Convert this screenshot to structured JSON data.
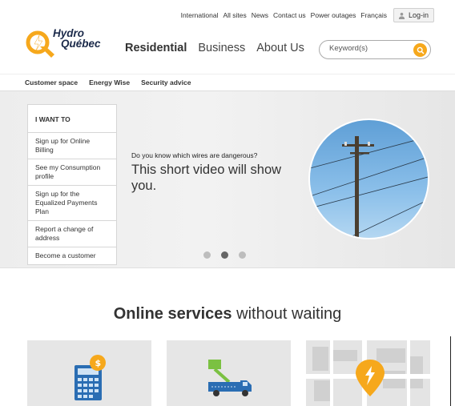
{
  "topbar": {
    "links": [
      "International",
      "All sites",
      "News",
      "Contact us",
      "Power outages",
      "Français"
    ],
    "login_label": "Log-in"
  },
  "logo": {
    "line1": "Hydro",
    "line2": "Québec"
  },
  "mainnav": {
    "items": [
      "Residential",
      "Business",
      "About Us"
    ]
  },
  "search": {
    "placeholder": "Keyword(s)"
  },
  "subnav": {
    "items": [
      "Customer space",
      "Energy Wise",
      "Security advice"
    ]
  },
  "iwant": {
    "title": "I WANT TO",
    "items": [
      "Sign up for Online Billing",
      "See my Consumption profile",
      "Sign up for the Equalized Payments Plan",
      "Report a change of address",
      "Become a customer"
    ]
  },
  "hero": {
    "small_text": "Do you know which wires are dangerous?",
    "big_text": "This short video will show you.",
    "slide_count": 3,
    "active_slide": 2
  },
  "services": {
    "title_bold": "Online services",
    "title_rest": " without waiting"
  },
  "colors": {
    "accent_orange": "#f6a81c",
    "brand_navy": "#1b2a4a",
    "truck_blue": "#2a6db3",
    "truck_green": "#7bc142"
  }
}
